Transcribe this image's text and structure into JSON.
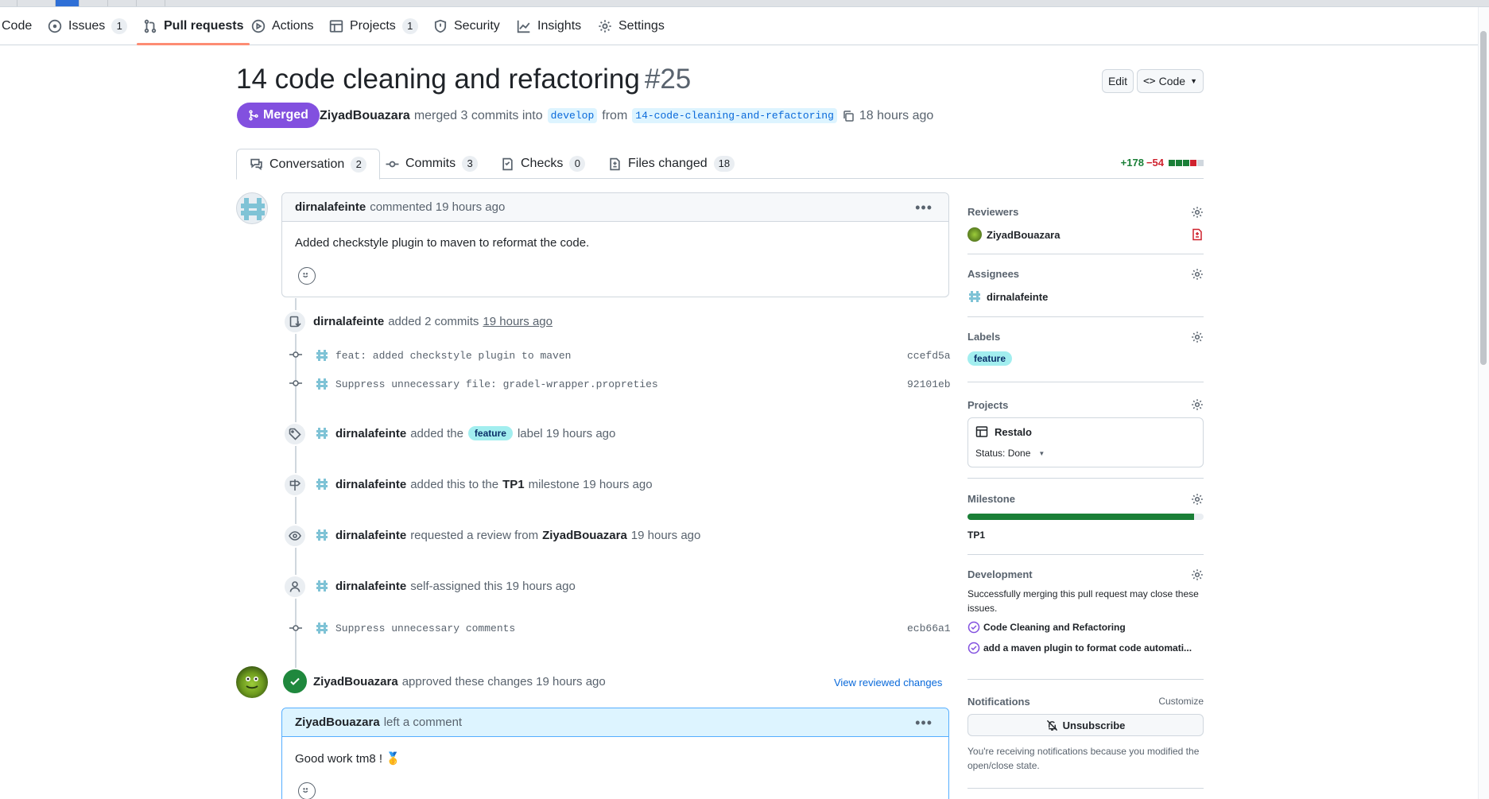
{
  "repo_nav": {
    "items": [
      {
        "label": "Code",
        "icon": "code-icon"
      },
      {
        "label": "Issues",
        "icon": "issue-icon",
        "count": "1"
      },
      {
        "label": "Pull requests",
        "icon": "pull-request-icon",
        "selected": true
      },
      {
        "label": "Actions",
        "icon": "play-icon"
      },
      {
        "label": "Projects",
        "icon": "table-icon",
        "count": "1"
      },
      {
        "label": "Security",
        "icon": "shield-icon"
      },
      {
        "label": "Insights",
        "icon": "graph-icon"
      },
      {
        "label": "Settings",
        "icon": "gear-icon"
      }
    ]
  },
  "pr": {
    "title": "14 code cleaning and refactoring",
    "number": "#25",
    "edit_label": "Edit",
    "code_label": "Code",
    "state": "Merged",
    "author": "ZiyadBouazara",
    "merge_text": "merged 3 commits into",
    "base_branch": "develop",
    "from_text": "from",
    "head_branch": "14-code-cleaning-and-refactoring",
    "time": "18 hours ago"
  },
  "tabs": [
    {
      "label": "Conversation",
      "count": "2",
      "icon": "comment-icon"
    },
    {
      "label": "Commits",
      "count": "3",
      "icon": "commit-icon"
    },
    {
      "label": "Checks",
      "count": "0",
      "icon": "checklist-icon"
    },
    {
      "label": "Files changed",
      "count": "18",
      "icon": "file-diff-icon"
    }
  ],
  "diffstat": {
    "additions": "+178",
    "deletions": "−54"
  },
  "first_comment": {
    "author": "dirnalafeinte",
    "action": "commented 19 hours ago",
    "body": "Added checkstyle plugin to maven to reformat the code."
  },
  "timeline": {
    "commits_event": {
      "author": "dirnalafeinte",
      "text": "added 2 commits",
      "time": "19 hours ago"
    },
    "commits": [
      {
        "message": "feat: added checkstyle plugin to maven",
        "sha": "ccefd5a"
      },
      {
        "message": "Suppress unnecessary file: gradel-wrapper.propreties",
        "sha": "92101eb"
      }
    ],
    "label_event": {
      "author": "dirnalafeinte",
      "pre": "added the",
      "label": "feature",
      "post": "label 19 hours ago"
    },
    "milestone_event": {
      "author": "dirnalafeinte",
      "pre": "added this to the",
      "milestone": "TP1",
      "post": "milestone 19 hours ago"
    },
    "review_request_event": {
      "author": "dirnalafeinte",
      "pre": "requested a review from",
      "reviewer": "ZiyadBouazara",
      "post": "19 hours ago"
    },
    "assign_event": {
      "author": "dirnalafeinte",
      "text": "self-assigned this 19 hours ago"
    },
    "last_commit": {
      "message": "Suppress unnecessary comments",
      "sha": "ecb66a1"
    },
    "approval": {
      "author": "ZiyadBouazara",
      "text": "approved these changes 19 hours ago",
      "link": "View reviewed changes"
    },
    "review_comment": {
      "author": "ZiyadBouazara",
      "action": "left a comment",
      "body": "Good work tm8 ! 🥇"
    }
  },
  "sidebar": {
    "reviewers": {
      "heading": "Reviewers",
      "name": "ZiyadBouazara"
    },
    "assignees": {
      "heading": "Assignees",
      "name": "dirnalafeinte"
    },
    "labels": {
      "heading": "Labels",
      "label": "feature"
    },
    "projects": {
      "heading": "Projects",
      "name": "Restalo",
      "status": "Status: Done"
    },
    "milestone": {
      "heading": "Milestone",
      "name": "TP1",
      "progress": 0.96
    },
    "development": {
      "heading": "Development",
      "text": "Successfully merging this pull request may close these issues.",
      "issues": [
        "Code Cleaning and Refactoring",
        "add a maven plugin to format code automati..."
      ]
    },
    "notifications": {
      "heading": "Notifications",
      "customize": "Customize",
      "button": "Unsubscribe",
      "text": "You're receiving notifications because you modified the open/close state."
    }
  },
  "colors": {
    "merged": "#8250df",
    "label_bg": "#a2eeef",
    "accent_link": "#0969da",
    "progress": "#1a7f37"
  }
}
